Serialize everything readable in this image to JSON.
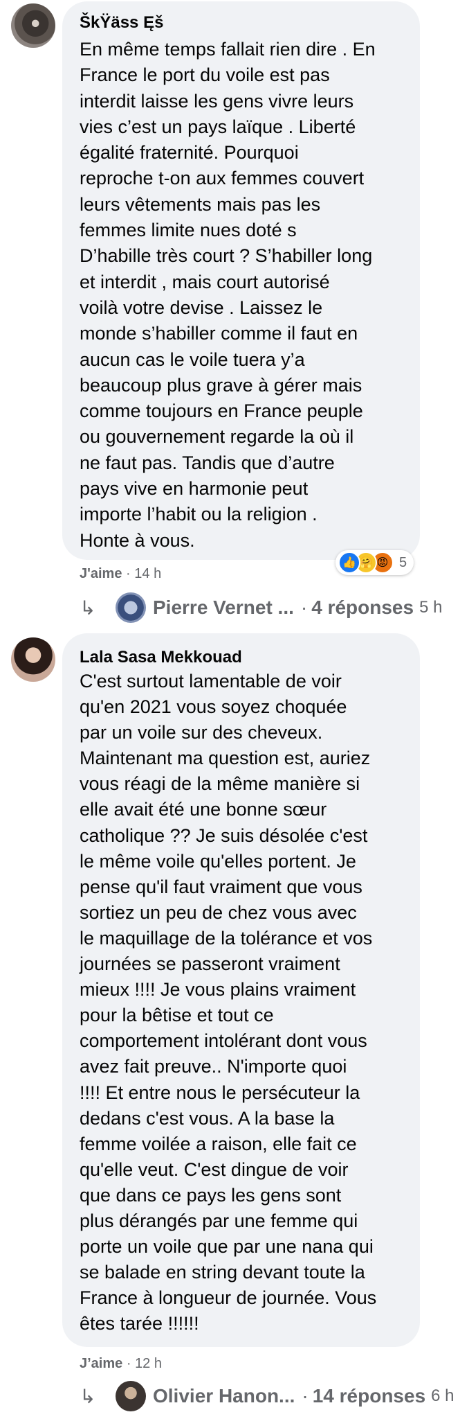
{
  "comments": [
    {
      "author": "ŠkŸäss Ęš",
      "text": "En même temps fallait rien dire . En\nFrance le port du voile est pas\ninterdit laisse les gens vivre leurs\nvies c’est un pays laïque . Liberté\négalité fraternité. Pourquoi\nreproche t-on aux femmes couvert\nleurs vêtements mais pas les\nfemmes limite nues doté s\nD’habille très court ? S’habiller long\net interdit , mais court autorisé\nvoilà votre devise . Laissez le\nmonde s’habiller comme il faut en\naucun cas le voile tuera y’a\nbeaucoup plus grave à gérer mais\ncomme toujours en France peuple\nou gouvernement regarde la où il\nne faut pas. Tandis que d’autre\npays vive en harmonie peut\nimporte l’habit ou la religion .\nHonte à vous.",
      "like_label": "J'aime",
      "separator": "·",
      "time": "14 h",
      "reactions": {
        "icons": [
          "like-icon",
          "care-icon",
          "angry-icon"
        ],
        "count": "5"
      },
      "replies": {
        "arrow": "↳",
        "name": "Pierre Vernet ...",
        "separator": "·",
        "count_label": "4 réponses",
        "time": "5 h"
      }
    },
    {
      "author": "Lala Sasa Mekkouad",
      "text": "C'est surtout lamentable de voir\nqu'en 2021 vous soyez choquée\npar un voile sur des cheveux.\nMaintenant ma question est, auriez\nvous réagi de la même manière si\nelle avait été une bonne sœur\ncatholique ?? Je suis désolée c'est\nle même voile qu'elles portent. Je\npense qu'il faut vraiment que vous\nsortiez un peu de chez vous avec\nle maquillage de la tolérance et vos\njournées se passeront vraiment\nmieux !!!! Je vous plains vraiment\npour la bêtise et tout ce\ncomportement intolérant dont vous\navez fait preuve.. N'importe quoi\n!!!! Et entre nous le persécuteur la\ndedans c'est vous. A la base la\nfemme voilée a raison, elle fait ce\nqu'elle veut. C'est dingue de voir\nque dans ce pays les gens sont\nplus dérangés par une femme qui\nporte un voile que par une nana qui\nse balade en string devant toute la\nFrance à longueur de journée. Vous\nêtes tarée !!!!!!",
      "like_label": "J’aime",
      "separator": "·",
      "time": "12 h",
      "replies": {
        "arrow": "↳",
        "name": "Olivier Hanon...",
        "separator": "·",
        "count_label": "14 réponses",
        "time": "6 h"
      }
    }
  ],
  "colors": {
    "bubble": "#f0f2f5",
    "secondary_text": "#65676b",
    "like_blue": "#1877f2"
  }
}
